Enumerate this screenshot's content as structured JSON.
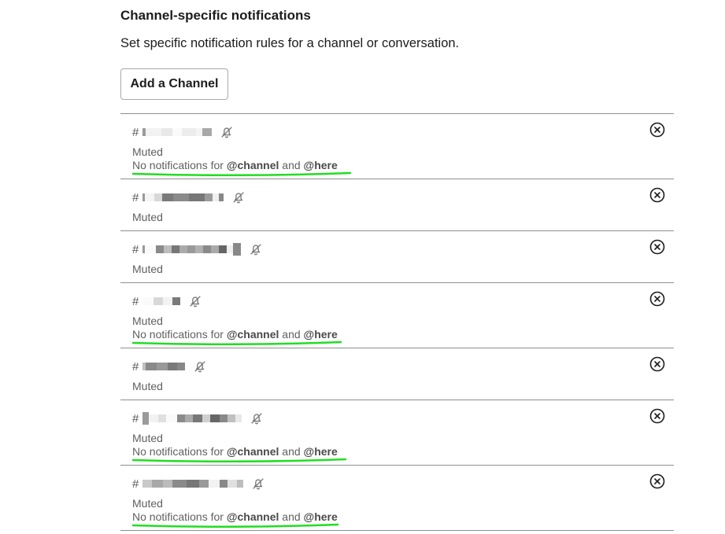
{
  "section": {
    "title": "Channel-specific notifications",
    "description": "Set specific notification rules for a channel or conversation.",
    "add_button_label": "Add a Channel"
  },
  "channels": [
    {
      "hash": "#",
      "status": "Muted",
      "rule_prefix": "No notifications for ",
      "rule_channel": "@channel",
      "rule_and": " and ",
      "rule_here": "@here",
      "has_rule": true
    },
    {
      "hash": "#",
      "status": "Muted",
      "has_rule": false
    },
    {
      "hash": "#",
      "status": "Muted",
      "has_rule": false
    },
    {
      "hash": "#",
      "status": "Muted",
      "rule_prefix": "No notifications for ",
      "rule_channel": "@channel",
      "rule_and": " and ",
      "rule_here": "@here",
      "has_rule": true
    },
    {
      "hash": "#",
      "status": "Muted",
      "has_rule": false
    },
    {
      "hash": "#",
      "status": "Muted",
      "rule_prefix": "No notifications for ",
      "rule_channel": "@channel",
      "rule_and": " and ",
      "rule_here": "@here",
      "has_rule": true
    },
    {
      "hash": "#",
      "status": "Muted",
      "rule_prefix": "No notifications for ",
      "rule_channel": "@channel",
      "rule_and": " and ",
      "rule_here": "@here",
      "has_rule": true
    }
  ],
  "icons": {
    "mute": "bell-off-icon",
    "remove": "close-circle-icon"
  },
  "colors": {
    "highlight_underline": "#22dd22",
    "border": "#8e8e8e",
    "muted_text": "#616061"
  }
}
